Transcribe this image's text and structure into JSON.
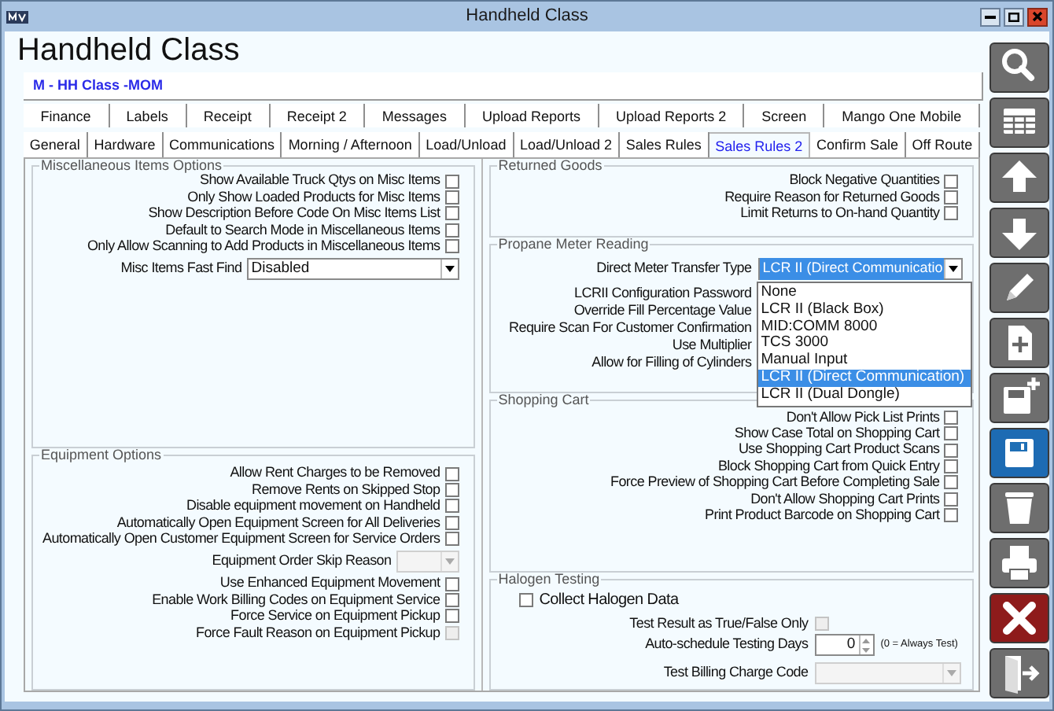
{
  "window": {
    "title": "Handheld Class"
  },
  "heading": "Handheld Class",
  "record_label": "M - HH Class -MOM",
  "tab_rows": [
    [
      {
        "label": "Finance",
        "selected": false
      },
      {
        "label": "Labels",
        "selected": false
      },
      {
        "label": "Receipt",
        "selected": false
      },
      {
        "label": "Receipt 2",
        "selected": false
      },
      {
        "label": "Messages",
        "selected": false
      },
      {
        "label": "Upload Reports",
        "selected": false
      },
      {
        "label": "Upload Reports 2",
        "selected": false
      },
      {
        "label": "Screen",
        "selected": false
      },
      {
        "label": "Mango One Mobile",
        "selected": false
      }
    ],
    [
      {
        "label": "General",
        "selected": false
      },
      {
        "label": "Hardware",
        "selected": false
      },
      {
        "label": "Communications",
        "selected": false
      },
      {
        "label": "Morning / Afternoon",
        "selected": false
      },
      {
        "label": "Load/Unload",
        "selected": false
      },
      {
        "label": "Load/Unload 2",
        "selected": false
      },
      {
        "label": "Sales Rules",
        "selected": false
      },
      {
        "label": "Sales Rules 2",
        "selected": true
      },
      {
        "label": "Confirm Sale",
        "selected": false
      },
      {
        "label": "Off Route",
        "selected": false
      }
    ]
  ],
  "columns": [
    {
      "groups": [
        {
          "title": "Miscellaneous Items Options",
          "kind": "checklist",
          "items": [
            {
              "kind": "checkbox",
              "label": "Show Available Truck Qtys on Misc Items",
              "checked": false,
              "disabled": false
            },
            {
              "kind": "checkbox",
              "label": "Only Show Loaded Products for Misc Items",
              "checked": false,
              "disabled": false
            },
            {
              "kind": "checkbox",
              "label": "Show Description Before Code On Misc Items List",
              "checked": false,
              "disabled": false
            },
            {
              "kind": "checkbox",
              "label": "Default to Search Mode in Miscellaneous Items",
              "checked": false,
              "disabled": false
            },
            {
              "kind": "checkbox",
              "label": "Only Allow Scanning to Add Products in Miscellaneous Items",
              "checked": false,
              "disabled": false
            },
            {
              "kind": "select",
              "label": "Misc Items Fast Find",
              "value": "Disabled",
              "disabled": false
            }
          ]
        },
        {
          "title": "Equipment Options",
          "kind": "checklist",
          "items": [
            {
              "kind": "checkbox",
              "label": "Allow Rent Charges to be Removed",
              "checked": false,
              "disabled": false
            },
            {
              "kind": "checkbox",
              "label": "Remove Rents on Skipped Stop",
              "checked": false,
              "disabled": false
            },
            {
              "kind": "checkbox",
              "label": "Disable equipment movement on Handheld",
              "checked": false,
              "disabled": false
            },
            {
              "kind": "checkbox",
              "label": "Automatically Open Equipment Screen for All Deliveries",
              "checked": false,
              "disabled": false
            },
            {
              "kind": "checkbox",
              "label": "Automatically Open Customer Equipment Screen for Service Orders",
              "checked": false,
              "disabled": false
            },
            {
              "kind": "select",
              "label": "Equipment Order Skip Reason",
              "disabled": true
            },
            {
              "kind": "checkbox",
              "label": "Use Enhanced Equipment Movement",
              "checked": false,
              "disabled": false
            },
            {
              "kind": "checkbox",
              "label": "Enable Work Billing Codes on Equipment Service",
              "checked": false,
              "disabled": false
            },
            {
              "kind": "checkbox",
              "label": "Force Service on Equipment Pickup",
              "checked": false,
              "disabled": false
            },
            {
              "kind": "checkbox",
              "label": "Force Fault Reason on Equipment Pickup",
              "checked": false,
              "disabled": true
            }
          ]
        }
      ]
    },
    {
      "groups": [
        {
          "title": "Returned Goods",
          "kind": "checklist",
          "items": [
            {
              "kind": "checkbox",
              "label": "Block Negative Quantities",
              "checked": false,
              "disabled": false
            },
            {
              "kind": "checkbox",
              "label": "Require Reason for Returned Goods",
              "checked": false,
              "disabled": false
            },
            {
              "kind": "checkbox",
              "label": "Limit Returns to On-hand Quantity",
              "checked": false,
              "disabled": false
            }
          ]
        },
        {
          "title": "Propane Meter Reading",
          "kind": "form",
          "items": [
            {
              "kind": "select",
              "label": "Direct Meter Transfer Type",
              "value": "LCR II (Direct Communicatio",
              "disabled": false,
              "focused": true,
              "options": [
                {
                  "label": "None",
                  "selected": false
                },
                {
                  "label": "LCR II (Black Box)",
                  "selected": false
                },
                {
                  "label": "MID:COMM 8000",
                  "selected": false
                },
                {
                  "label": "TCS 3000",
                  "selected": false
                },
                {
                  "label": "Manual Input",
                  "selected": false
                },
                {
                  "label": "LCR II (Direct Communication)",
                  "selected": true
                },
                {
                  "label": "LCR II (Dual Dongle)",
                  "selected": false
                }
              ]
            },
            {
              "kind": "label",
              "label": "LCRII Configuration Password"
            },
            {
              "kind": "label",
              "label": "Override Fill Percentage Value"
            },
            {
              "kind": "label",
              "label": "Require Scan For Customer Confirmation"
            },
            {
              "kind": "label",
              "label": "Use Multiplier"
            },
            {
              "kind": "label",
              "label": "Allow for Filling of Cylinders"
            }
          ]
        },
        {
          "title": "Shopping Cart",
          "kind": "checklist",
          "items": [
            {
              "kind": "checkbox",
              "label": "Don't Allow Pick List Prints",
              "checked": false,
              "disabled": false
            },
            {
              "kind": "checkbox",
              "label": "Show Case Total on Shopping Cart",
              "checked": false,
              "disabled": false
            },
            {
              "kind": "checkbox",
              "label": "Use Shopping Cart Product Scans",
              "checked": false,
              "disabled": false
            },
            {
              "kind": "checkbox",
              "label": "Block Shopping Cart from Quick Entry",
              "checked": false,
              "disabled": false
            },
            {
              "kind": "checkbox",
              "label": "Force Preview of Shopping Cart Before Completing Sale",
              "checked": false,
              "disabled": false
            },
            {
              "kind": "checkbox",
              "label": "Don't Allow Shopping Cart Prints",
              "checked": false,
              "disabled": false
            },
            {
              "kind": "checkbox",
              "label": "Print Product Barcode on Shopping Cart",
              "checked": false,
              "disabled": false
            }
          ]
        },
        {
          "title": "Halogen Testing",
          "kind": "form",
          "items": [
            {
              "kind": "checkbox_left",
              "label": "Collect Halogen Data",
              "checked": false,
              "disabled": false
            },
            {
              "kind": "checkbox",
              "label": "Test Result as True/False Only",
              "checked": false,
              "disabled": true
            },
            {
              "kind": "spinner",
              "label": "Auto-schedule Testing Days",
              "value": "0",
              "note": "(0 = Always Test)"
            },
            {
              "kind": "select",
              "label": "Test Billing Charge Code",
              "disabled": true
            }
          ]
        }
      ]
    }
  ],
  "toolbar": [
    {
      "kind": "search"
    },
    {
      "kind": "grid"
    },
    {
      "kind": "up"
    },
    {
      "kind": "down"
    },
    {
      "kind": "edit"
    },
    {
      "kind": "new"
    },
    {
      "kind": "save_new"
    },
    {
      "kind": "save"
    },
    {
      "kind": "delete"
    },
    {
      "kind": "print"
    },
    {
      "kind": "cancel"
    },
    {
      "kind": "exit"
    }
  ]
}
